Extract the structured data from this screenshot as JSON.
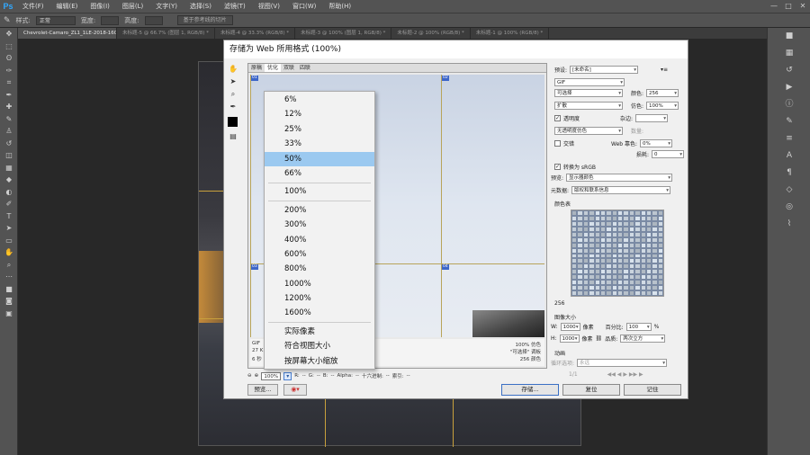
{
  "app": {
    "logo": "Ps"
  },
  "menubar": {
    "items": [
      "文件(F)",
      "编辑(E)",
      "图像(I)",
      "图层(L)",
      "文字(Y)",
      "选择(S)",
      "滤镜(T)",
      "视图(V)",
      "窗口(W)",
      "帮助(H)"
    ],
    "window_controls": [
      "—",
      "□",
      "✕"
    ]
  },
  "options_bar": {
    "style_label": "样式:",
    "style_value": "正常",
    "width_label": "宽度:",
    "height_label": "高度:",
    "button": "基于参考线的切片"
  },
  "doc_tabs": [
    {
      "label": "Chevrolet-Camaro_ZL1_1LE-2018-1600-02.jpg @ 66.7%(RGB/8#) *",
      "active": true
    },
    {
      "label": "未标题-5 @ 66.7% (图层 1, RGB/8) *",
      "active": false
    },
    {
      "label": "未标题-4 @ 33.3% (RGB/8) *",
      "active": false
    },
    {
      "label": "未标题-3 @ 100% (图层 1, RGB/8) *",
      "active": false
    },
    {
      "label": "未标题-2 @ 100% (RGB/8) *",
      "active": false
    },
    {
      "label": "未标题-1 @ 100% (RGB/8) *",
      "active": false
    }
  ],
  "dialog": {
    "title": "存储为 Web 所用格式 (100%)",
    "preview_tabs": [
      "原稿",
      "优化",
      "双联",
      "四联"
    ],
    "slice_labels": [
      "01",
      "02",
      "03",
      "04",
      "05",
      "06"
    ],
    "status_left": [
      "GIF",
      "27 K",
      "6 秒"
    ],
    "status_right": [
      "100% 仿色",
      "\"可选择\" 调板",
      "256 颜色"
    ],
    "zoom": {
      "value": "100%",
      "arrow": "▾",
      "r_label": "R:",
      "g_label": "G:",
      "b_label": "B:",
      "r": "--",
      "g": "--",
      "b": "--",
      "alpha_label": "Alpha:",
      "alpha": "--",
      "hex_label": "十六进制:",
      "hex": "--",
      "index_label": "索引:",
      "index": "--"
    },
    "preview_button": "预览...",
    "save_button": "存储...",
    "cancel_button": "复位",
    "done_button": "记住"
  },
  "settings": {
    "preset_label": "预设:",
    "preset_value": "[未命名]",
    "format": "GIF",
    "reduction": "可选择",
    "dither_algo": "扩散",
    "transparency_label": "透明度",
    "transparency_dither": "无透明度仿色",
    "interlaced_label": "交错",
    "colors_label": "颜色:",
    "colors_value": "256",
    "dither_label": "仿色:",
    "dither_value": "100%",
    "matte_label": "杂边:",
    "amount_label": "数量:",
    "web_snap_label": "Web 靠色:",
    "web_snap_value": "0%",
    "lossy_label": "损耗:",
    "lossy_value": "0",
    "convert_srgb_label": "转换为 sRGB",
    "preview_label": "预览:",
    "preview_value": "显示器颜色",
    "metadata_label": "元数据:",
    "metadata_value": "版权和联系信息",
    "color_table_label": "颜色表",
    "color_count": "256",
    "image_size_label": "图像大小",
    "w_label": "W:",
    "w_value": "1000",
    "h_label": "H:",
    "h_value": "1000",
    "px_label": "像素",
    "percent_label": "百分比:",
    "percent_value": "100",
    "percent_unit": "%",
    "quality_label": "品质:",
    "quality_value": "两次立方",
    "animation_label": "动画",
    "loop_label": "循环选项:",
    "loop_value": "永远",
    "frame_counter": "1/1"
  },
  "zoom_menu": {
    "items": [
      "6%",
      "12%",
      "25%",
      "33%",
      "50%",
      "66%",
      "100%",
      "200%",
      "300%",
      "400%",
      "600%",
      "800%",
      "1000%",
      "1200%",
      "1600%",
      "实际像素",
      "符合视图大小",
      "按屏幕大小缩放"
    ],
    "selected": "50%"
  }
}
